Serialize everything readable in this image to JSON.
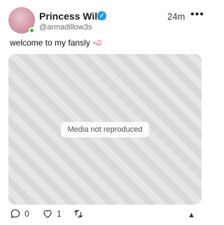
{
  "post": {
    "display_name": "Princess Wil...",
    "username": "@armadillow3s",
    "time": "24m",
    "more": "•••",
    "text": "welcome to my fansly",
    "emoji": "🪱"
  },
  "media": {
    "label": "Media not reproduced"
  },
  "actions": {
    "comments": "0",
    "likes": "1"
  },
  "colors": {
    "verified": "#1d9bf0",
    "online": "#2fbf4a"
  }
}
